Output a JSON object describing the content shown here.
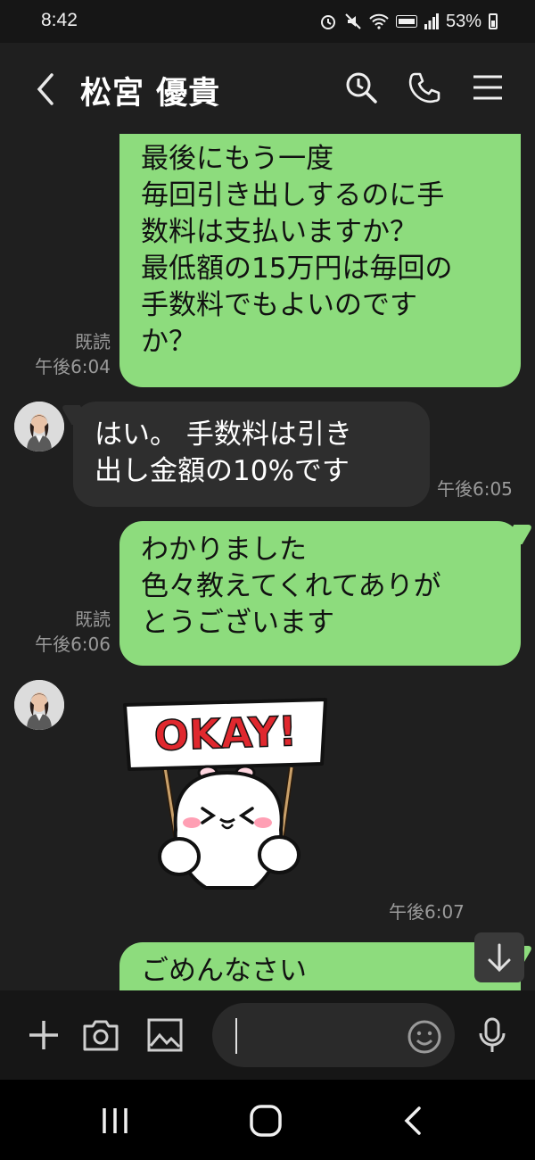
{
  "status_bar": {
    "time": "8:42",
    "battery": "53%"
  },
  "header": {
    "title": "松宮 優貴"
  },
  "messages": [
    {
      "dir": "out",
      "lines": [
        "最後にもう一度",
        "毎回引き出しするのに手",
        "数料は支払いますか？",
        "最低額の15万円は毎回の",
        "手数料でもよいのです",
        "か？"
      ],
      "read": "既読",
      "time": "午後6:04"
    },
    {
      "dir": "in",
      "lines": [
        "はい。 手数料は引き",
        "出し金額の10%です"
      ],
      "time": "午後6:05"
    },
    {
      "dir": "out",
      "lines": [
        "わかりました",
        "色々教えてくれてありが",
        "とうございます"
      ],
      "read": "既読",
      "time": "午後6:06"
    },
    {
      "dir": "in",
      "type": "sticker",
      "sticker_text": "OKAY!",
      "time": "午後6:07"
    },
    {
      "dir": "out",
      "lines": [
        "ごめんなさい"
      ]
    }
  ],
  "input": {
    "placeholder": ""
  },
  "colors": {
    "bubble_out": "#8ddc7d",
    "bubble_in": "#2e2e2e",
    "background": "#1f1f1f"
  }
}
